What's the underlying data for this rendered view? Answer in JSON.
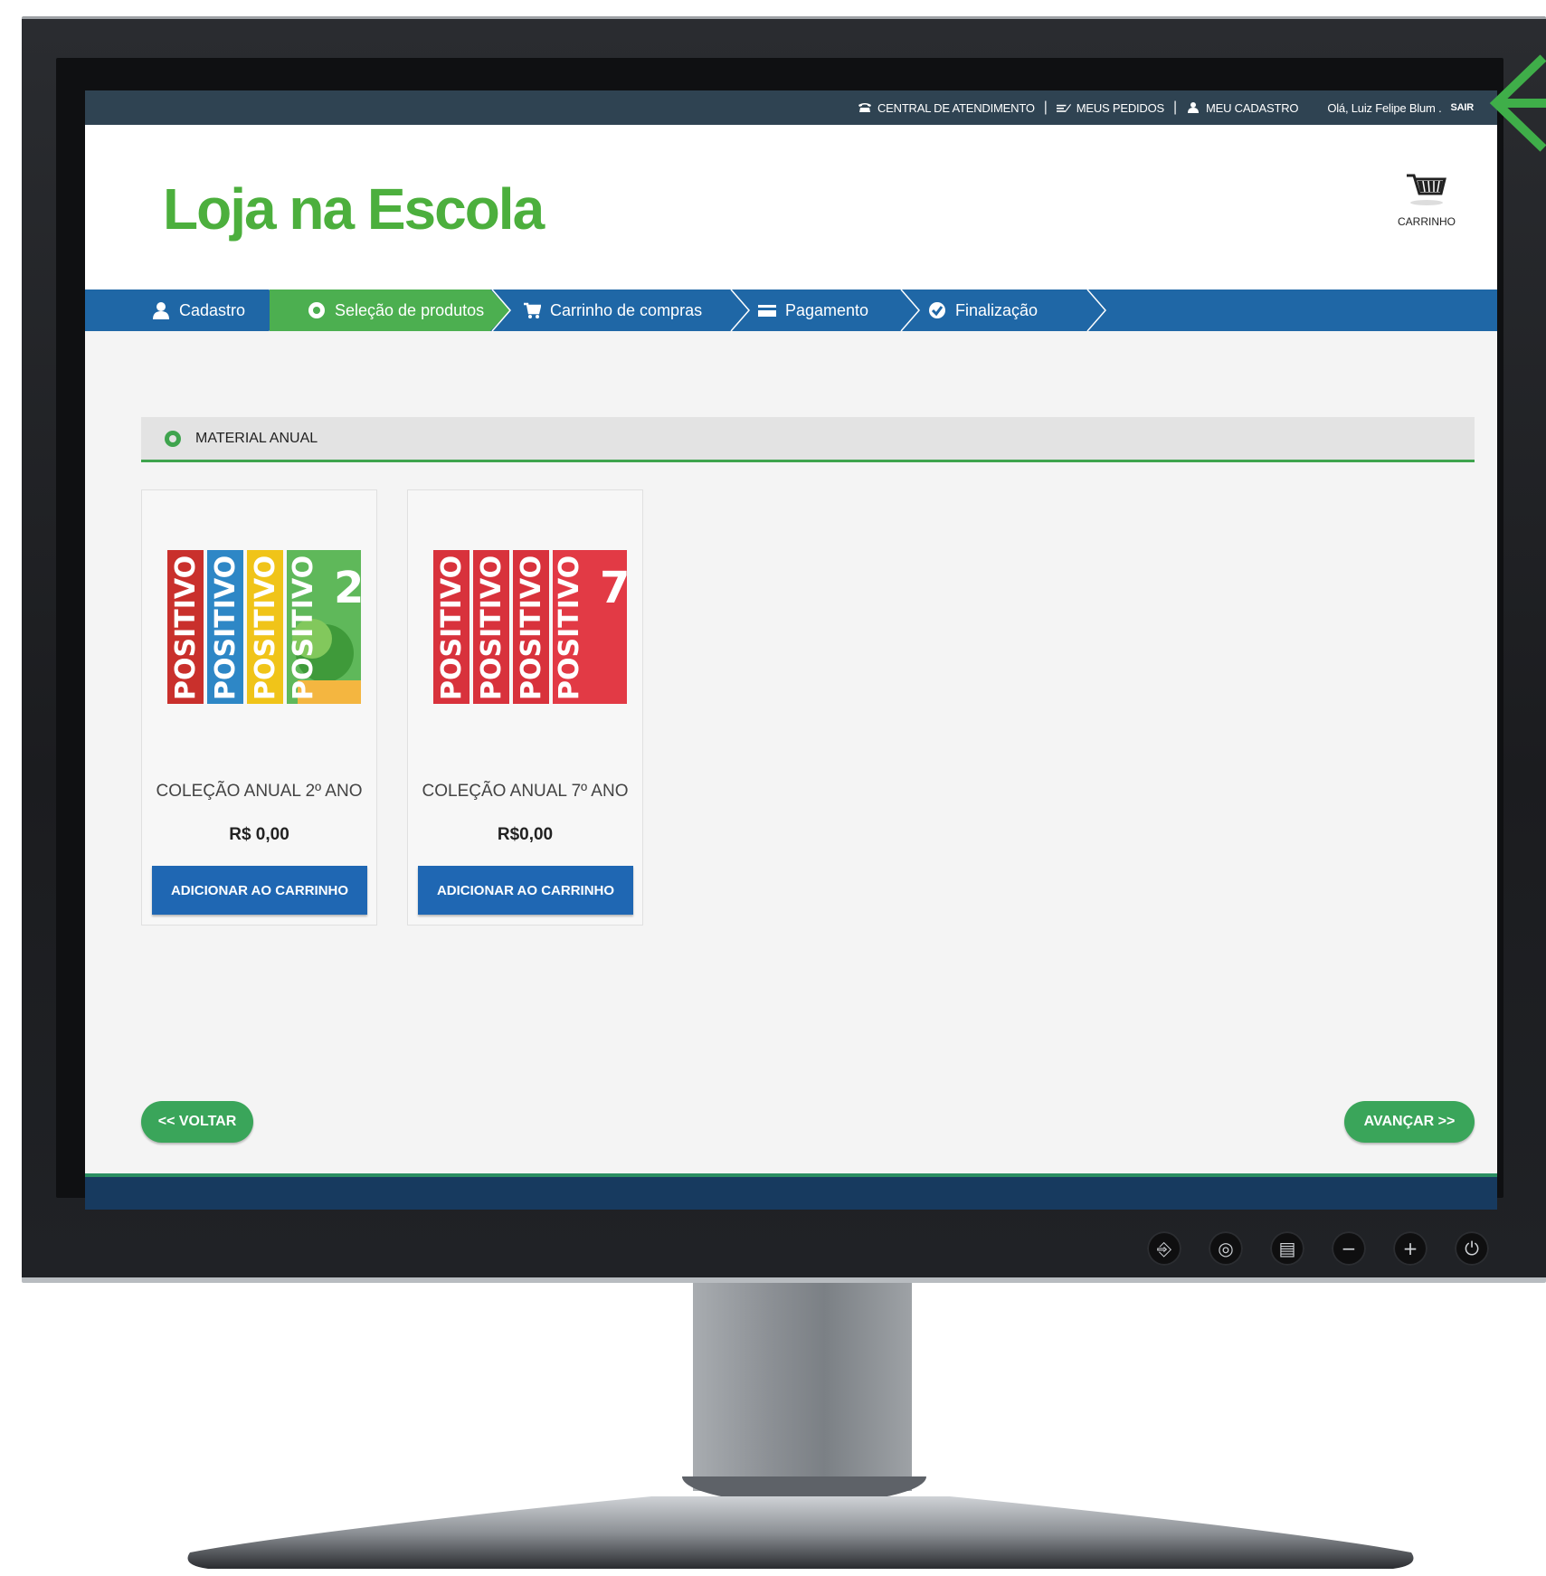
{
  "topbar": {
    "support": "CENTRAL DE ATENDIMENTO",
    "orders": "MEUS PEDIDOS",
    "account": "MEU CADASTRO",
    "greeting": "Olá, Luiz Felipe Blum .",
    "logout": "SAIR"
  },
  "header": {
    "logo": "Loja na Escola",
    "cart_label": "CARRINHO"
  },
  "steps": [
    {
      "label": "Cadastro",
      "icon": "user-icon"
    },
    {
      "label": "Seleção de produtos",
      "icon": "circle-icon"
    },
    {
      "label": "Carrinho de compras",
      "icon": "cart-icon"
    },
    {
      "label": "Pagamento",
      "icon": "card-icon"
    },
    {
      "label": "Finalização",
      "icon": "check-circle-icon"
    }
  ],
  "active_step": "Seleção de produtos",
  "section": {
    "title": "MATERIAL ANUAL"
  },
  "products": [
    {
      "name": "COLEÇÃO ANUAL 2º ANO",
      "price": "R$ 0,00",
      "cover_number": "2",
      "cover_brand": "POSITIVO",
      "button": "ADICIONAR AO CARRINHO"
    },
    {
      "name": "COLEÇÃO ANUAL 7º ANO",
      "price": "R$0,00",
      "cover_number": "7",
      "cover_brand": "POSITIVO",
      "button": "ADICIONAR AO CARRINHO"
    }
  ],
  "nav": {
    "back": "<< VOLTAR",
    "next": "AVANÇAR >>"
  },
  "monitor_controls": [
    "input-icon",
    "source-icon",
    "menu-icon",
    "minus-icon",
    "plus-icon",
    "power-icon"
  ],
  "colors": {
    "brand_green": "#4caf3d",
    "steps_blue": "#1f67a6",
    "active_step_green": "#4caf50",
    "button_blue": "#1f67b3",
    "nav_green": "#3aa55a",
    "topbar": "#2f4352"
  }
}
